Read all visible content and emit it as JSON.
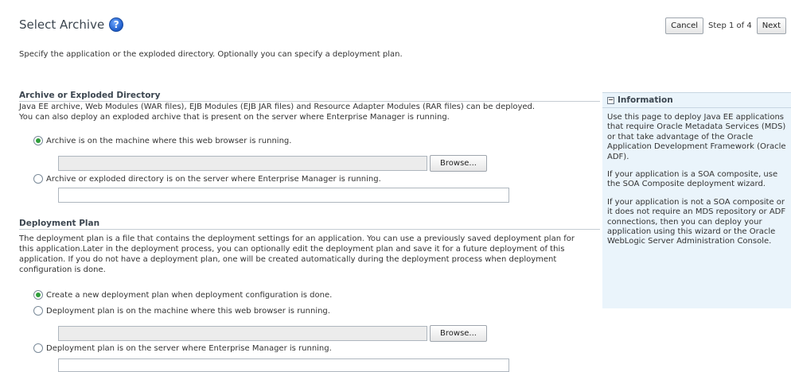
{
  "header": {
    "title": "Select Archive",
    "help_icon": "?",
    "subtitle": "Specify the application or the exploded directory. Optionally you can specify a deployment plan."
  },
  "train": {
    "cancel_label": "Cancel",
    "step_text": "Step 1 of 4",
    "next_label": "Next"
  },
  "archive_section": {
    "header": "Archive or Exploded Directory",
    "description": "Java EE archive, Web Modules (WAR files), EJB Modules (EJB JAR files) and Resource Adapter Modules (RAR files) can be deployed. You can also deploy an exploded archive that is present on the server where Enterprise Manager is running.",
    "option_local": "Archive is on the machine where this web browser is running.",
    "option_server": "Archive or exploded directory is on the server where Enterprise Manager is running.",
    "selected": "local",
    "local_value": "",
    "server_value": "",
    "browse_label": "Browse..."
  },
  "plan_section": {
    "header": "Deployment Plan",
    "description": "The deployment plan is a file that contains the deployment settings for an application. You can use a previously saved deployment plan for this application.Later in the deployment process, you can optionally edit the deployment plan and save it for a future deployment of this application. If you do not have a deployment plan, one will be created automatically during the deployment process when deployment configuration is done.",
    "option_new": "Create a new deployment plan when deployment configuration is done.",
    "option_local": "Deployment plan is on the machine where this web browser is running.",
    "option_server": "Deployment plan is on the server where Enterprise Manager is running.",
    "selected": "new",
    "local_value": "",
    "server_value": "",
    "browse_label": "Browse..."
  },
  "info_panel": {
    "title": "Information",
    "collapse_icon": "−",
    "paragraphs": [
      "Use this page to deploy Java EE applications that require Oracle Metadata Services (MDS) or that take advantage of the Oracle Application Development Framework (Oracle ADF).",
      "If your application is a SOA composite, use the SOA Composite deployment wizard.",
      "If your application is not a SOA composite or it does not require an MDS repository or ADF connections, then you can deploy your application using this wizard or the Oracle WebLogic Server Administration Console."
    ]
  },
  "colors": {
    "accent_green": "#2f9e3b",
    "info_background": "#eaf4fb",
    "help_blue": "#1d5bc9"
  }
}
